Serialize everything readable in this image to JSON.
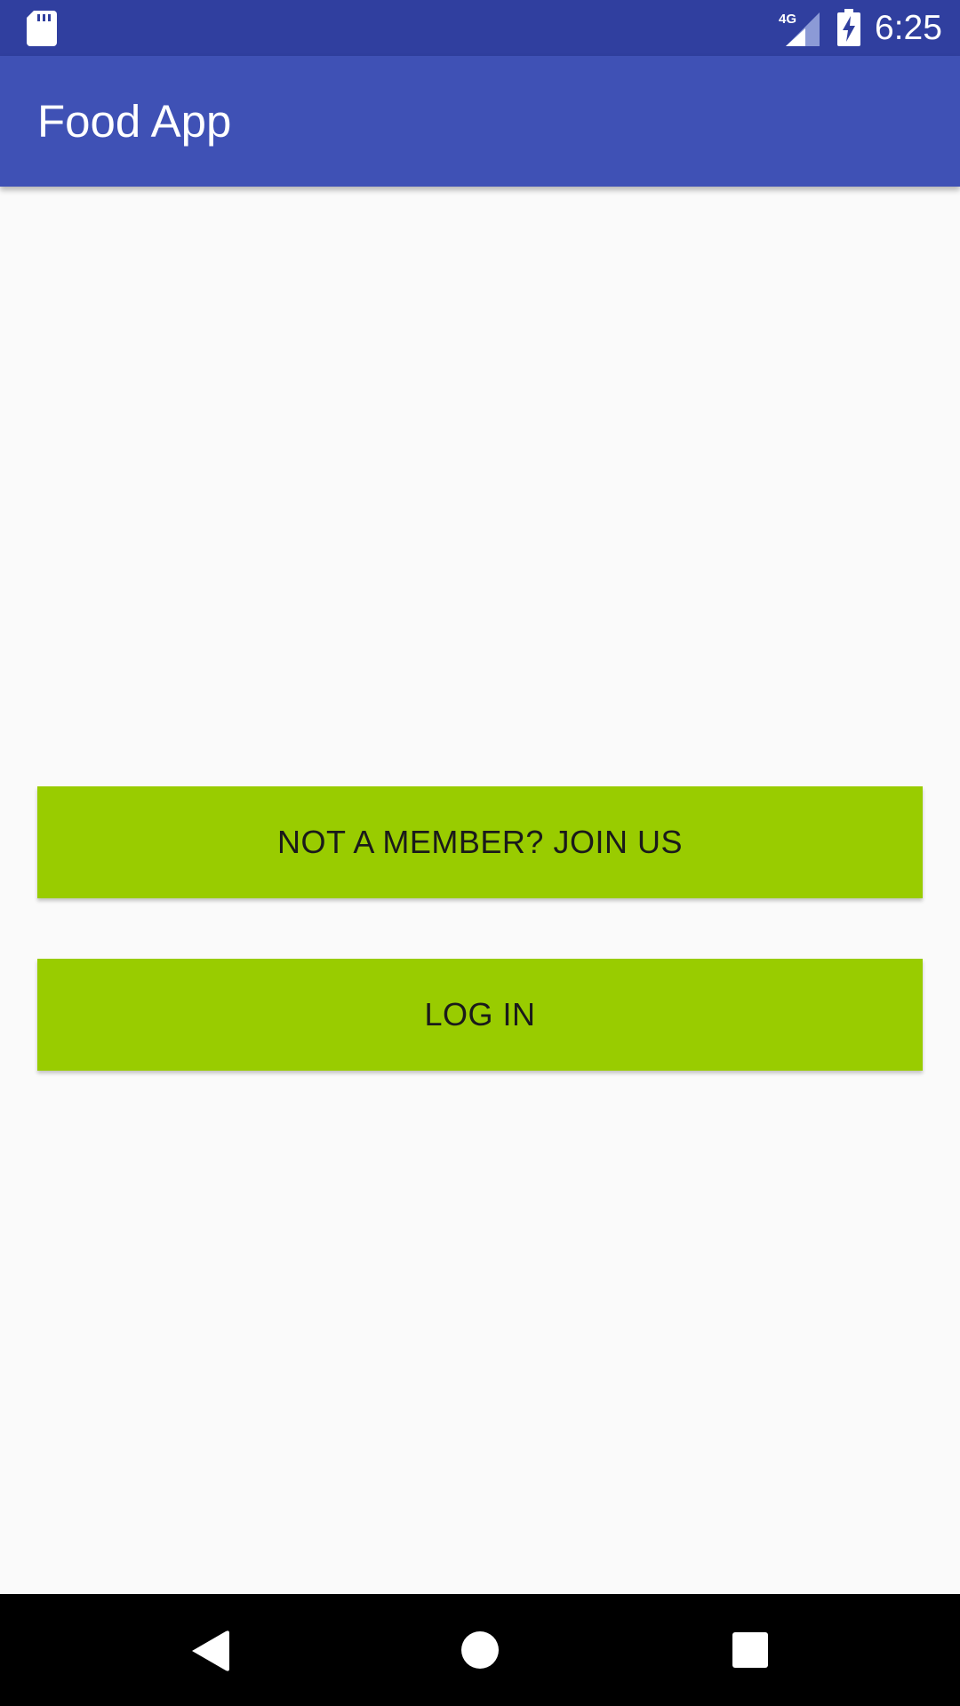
{
  "status_bar": {
    "time": "6:25",
    "network_label": "4G",
    "icons": [
      "sd-card-icon",
      "signal-icon",
      "battery-charging-icon"
    ],
    "background_color": "#303f9f"
  },
  "app_bar": {
    "title": "Food App",
    "background_color": "#3f51b5"
  },
  "main": {
    "join_button_label": "NOT A MEMBER? JOIN US",
    "login_button_label": "LOG IN",
    "button_color": "#99cc00"
  },
  "nav_bar": {
    "icons": [
      "back-icon",
      "home-icon",
      "recents-icon"
    ]
  }
}
